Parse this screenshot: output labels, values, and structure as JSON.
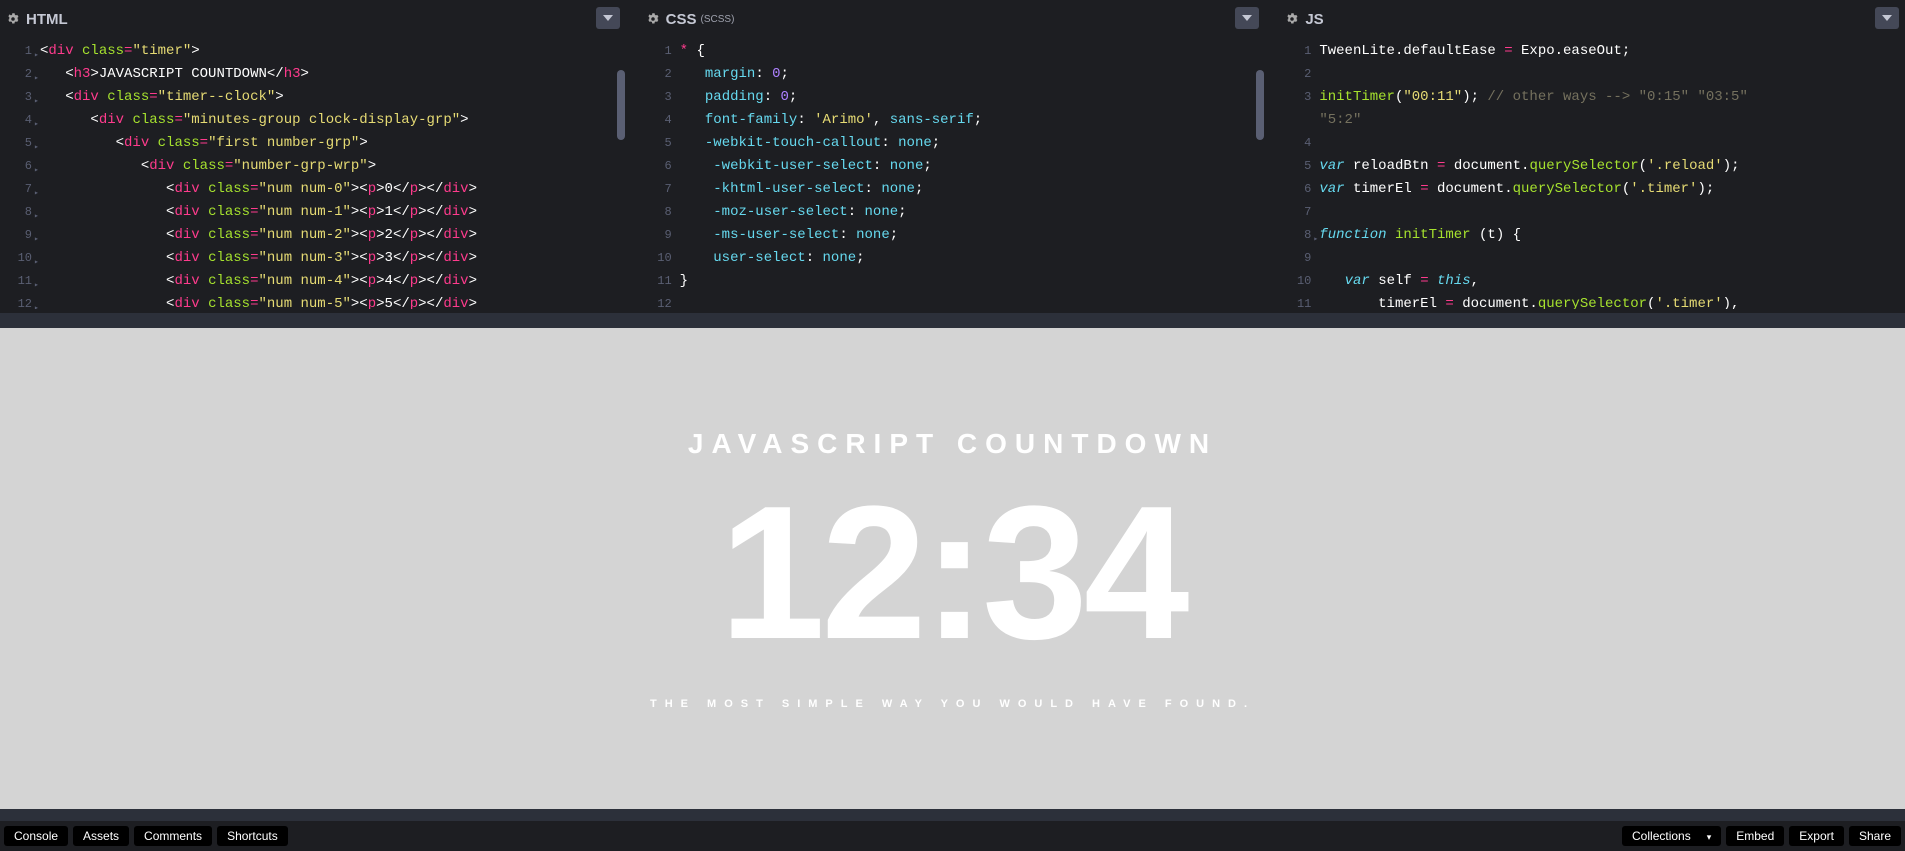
{
  "panels": {
    "html": {
      "title": "HTML",
      "subtitle": ""
    },
    "css": {
      "title": "CSS",
      "subtitle": "(SCSS)"
    },
    "js": {
      "title": "JS",
      "subtitle": ""
    }
  },
  "html_lines": [
    {
      "n": "1",
      "arr": true,
      "html": "<span class='pn'>&lt;</span><span class='tag'>div</span> <span class='attr'>class</span><span class='op'>=</span><span class='str'>\"timer\"</span><span class='pn'>&gt;</span>"
    },
    {
      "n": "2",
      "arr": true,
      "html": "   <span class='pn'>&lt;</span><span class='tag'>h3</span><span class='pn'>&gt;</span><span class='txt'>JAVASCRIPT COUNTDOWN</span><span class='pn'>&lt;/</span><span class='tag'>h3</span><span class='pn'>&gt;</span>"
    },
    {
      "n": "3",
      "arr": true,
      "html": "   <span class='pn'>&lt;</span><span class='tag'>div</span> <span class='attr'>class</span><span class='op'>=</span><span class='str'>\"timer--clock\"</span><span class='pn'>&gt;</span>"
    },
    {
      "n": "4",
      "arr": true,
      "html": "      <span class='pn'>&lt;</span><span class='tag'>div</span> <span class='attr'>class</span><span class='op'>=</span><span class='str'>\"minutes-group clock-display-grp\"</span><span class='pn'>&gt;</span>"
    },
    {
      "n": "5",
      "arr": true,
      "html": "         <span class='pn'>&lt;</span><span class='tag'>div</span> <span class='attr'>class</span><span class='op'>=</span><span class='str'>\"first number-grp\"</span><span class='pn'>&gt;</span>"
    },
    {
      "n": "6",
      "arr": true,
      "html": "            <span class='pn'>&lt;</span><span class='tag'>div</span> <span class='attr'>class</span><span class='op'>=</span><span class='str'>\"number-grp-wrp\"</span><span class='pn'>&gt;</span>"
    },
    {
      "n": "7",
      "arr": true,
      "html": "               <span class='pn'>&lt;</span><span class='tag'>div</span> <span class='attr'>class</span><span class='op'>=</span><span class='str'>\"num num-0\"</span><span class='pn'>&gt;&lt;</span><span class='tag'>p</span><span class='pn'>&gt;</span><span class='txt'>0</span><span class='pn'>&lt;/</span><span class='tag'>p</span><span class='pn'>&gt;&lt;/</span><span class='tag'>div</span><span class='pn'>&gt;</span>"
    },
    {
      "n": "8",
      "arr": true,
      "html": "               <span class='pn'>&lt;</span><span class='tag'>div</span> <span class='attr'>class</span><span class='op'>=</span><span class='str'>\"num num-1\"</span><span class='pn'>&gt;&lt;</span><span class='tag'>p</span><span class='pn'>&gt;</span><span class='txt'>1</span><span class='pn'>&lt;/</span><span class='tag'>p</span><span class='pn'>&gt;&lt;/</span><span class='tag'>div</span><span class='pn'>&gt;</span>"
    },
    {
      "n": "9",
      "arr": true,
      "html": "               <span class='pn'>&lt;</span><span class='tag'>div</span> <span class='attr'>class</span><span class='op'>=</span><span class='str'>\"num num-2\"</span><span class='pn'>&gt;&lt;</span><span class='tag'>p</span><span class='pn'>&gt;</span><span class='txt'>2</span><span class='pn'>&lt;/</span><span class='tag'>p</span><span class='pn'>&gt;&lt;/</span><span class='tag'>div</span><span class='pn'>&gt;</span>"
    },
    {
      "n": "10",
      "arr": true,
      "html": "               <span class='pn'>&lt;</span><span class='tag'>div</span> <span class='attr'>class</span><span class='op'>=</span><span class='str'>\"num num-3\"</span><span class='pn'>&gt;&lt;</span><span class='tag'>p</span><span class='pn'>&gt;</span><span class='txt'>3</span><span class='pn'>&lt;/</span><span class='tag'>p</span><span class='pn'>&gt;&lt;/</span><span class='tag'>div</span><span class='pn'>&gt;</span>"
    },
    {
      "n": "11",
      "arr": true,
      "html": "               <span class='pn'>&lt;</span><span class='tag'>div</span> <span class='attr'>class</span><span class='op'>=</span><span class='str'>\"num num-4\"</span><span class='pn'>&gt;&lt;</span><span class='tag'>p</span><span class='pn'>&gt;</span><span class='txt'>4</span><span class='pn'>&lt;/</span><span class='tag'>p</span><span class='pn'>&gt;&lt;/</span><span class='tag'>div</span><span class='pn'>&gt;</span>"
    },
    {
      "n": "12",
      "arr": true,
      "html": "               <span class='pn'>&lt;</span><span class='tag'>div</span> <span class='attr'>class</span><span class='op'>=</span><span class='str'>\"num num-5\"</span><span class='pn'>&gt;&lt;</span><span class='tag'>p</span><span class='pn'>&gt;</span><span class='txt'>5</span><span class='pn'>&lt;/</span><span class='tag'>p</span><span class='pn'>&gt;&lt;/</span><span class='tag'>div</span><span class='pn'>&gt;</span>"
    }
  ],
  "css_lines": [
    {
      "n": "1",
      "html": "<span class='tag'>*</span> <span class='pn'>{</span>"
    },
    {
      "n": "2",
      "html": "   <span class='prop'>margin</span><span class='pn'>:</span> <span class='num'>0</span><span class='pn'>;</span>"
    },
    {
      "n": "3",
      "html": "   <span class='prop'>padding</span><span class='pn'>:</span> <span class='num'>0</span><span class='pn'>;</span>"
    },
    {
      "n": "4",
      "html": "   <span class='prop'>font-family</span><span class='pn'>:</span> <span class='str'>'Arimo'</span><span class='pn'>,</span> <span class='prop'>sans-serif</span><span class='pn'>;</span>"
    },
    {
      "n": "5",
      "html": "   <span class='prop'>-webkit-touch-callout</span><span class='pn'>:</span> <span class='prop'>none</span><span class='pn'>;</span>"
    },
    {
      "n": "6",
      "html": "    <span class='prop'>-webkit-user-select</span><span class='pn'>:</span> <span class='prop'>none</span><span class='pn'>;</span>"
    },
    {
      "n": "7",
      "html": "    <span class='prop'>-khtml-user-select</span><span class='pn'>:</span> <span class='prop'>none</span><span class='pn'>;</span>"
    },
    {
      "n": "8",
      "html": "    <span class='prop'>-moz-user-select</span><span class='pn'>:</span> <span class='prop'>none</span><span class='pn'>;</span>"
    },
    {
      "n": "9",
      "html": "    <span class='prop'>-ms-user-select</span><span class='pn'>:</span> <span class='prop'>none</span><span class='pn'>;</span>"
    },
    {
      "n": "10",
      "html": "    <span class='prop'>user-select</span><span class='pn'>:</span> <span class='prop'>none</span><span class='pn'>;</span>"
    },
    {
      "n": "11",
      "html": "<span class='pn'>}</span>"
    },
    {
      "n": "12",
      "html": ""
    }
  ],
  "js_lines": [
    {
      "n": "1",
      "html": "<span class='obj'>TweenLite</span><span class='pn'>.</span><span class='obj'>defaultEase</span> <span class='op'>=</span> <span class='obj'>Expo</span><span class='pn'>.</span><span class='obj'>easeOut</span><span class='pn'>;</span>"
    },
    {
      "n": "2",
      "html": ""
    },
    {
      "n": "3",
      "html": "<span class='fn'>initTimer</span><span class='pn'>(</span><span class='str'>\"00:11\"</span><span class='pn'>);</span> <span class='cmt'>// other ways --&gt; \"0:15\" \"03:5\"</span>"
    },
    {
      "n": "",
      "html": "<span class='cmt'>\"5:2\"</span>"
    },
    {
      "n": "4",
      "html": ""
    },
    {
      "n": "5",
      "html": "<span class='kw'>var</span> <span class='obj'>reloadBtn</span> <span class='op'>=</span> <span class='obj'>document</span><span class='pn'>.</span><span class='fn'>querySelector</span><span class='pn'>(</span><span class='str'>'.reload'</span><span class='pn'>);</span>"
    },
    {
      "n": "6",
      "html": "<span class='kw'>var</span> <span class='obj'>timerEl</span> <span class='op'>=</span> <span class='obj'>document</span><span class='pn'>.</span><span class='fn'>querySelector</span><span class='pn'>(</span><span class='str'>'.timer'</span><span class='pn'>);</span>"
    },
    {
      "n": "7",
      "html": ""
    },
    {
      "n": "8",
      "arr": true,
      "html": "<span class='kw'>function</span> <span class='fn'>initTimer</span> <span class='pn'>(</span><span class='obj'>t</span><span class='pn'>)</span> <span class='pn'>{</span>"
    },
    {
      "n": "9",
      "html": ""
    },
    {
      "n": "10",
      "html": "   <span class='kw'>var</span> <span class='obj'>self</span> <span class='op'>=</span> <span class='kw'>this</span><span class='pn'>,</span>"
    },
    {
      "n": "11",
      "html": "       <span class='obj'>timerEl</span> <span class='op'>=</span> <span class='obj'>document</span><span class='pn'>.</span><span class='fn'>querySelector</span><span class='pn'>(</span><span class='str'>'.timer'</span><span class='pn'>),</span>"
    }
  ],
  "preview": {
    "title": "JAVASCRIPT COUNTDOWN",
    "clock": "12:34",
    "tagline": "THE MOST SIMPLE WAY YOU WOULD HAVE FOUND."
  },
  "footer": {
    "console": "Console",
    "assets": "Assets",
    "comments": "Comments",
    "shortcuts": "Shortcuts",
    "collections": "Collections",
    "embed": "Embed",
    "export": "Export",
    "share": "Share"
  }
}
